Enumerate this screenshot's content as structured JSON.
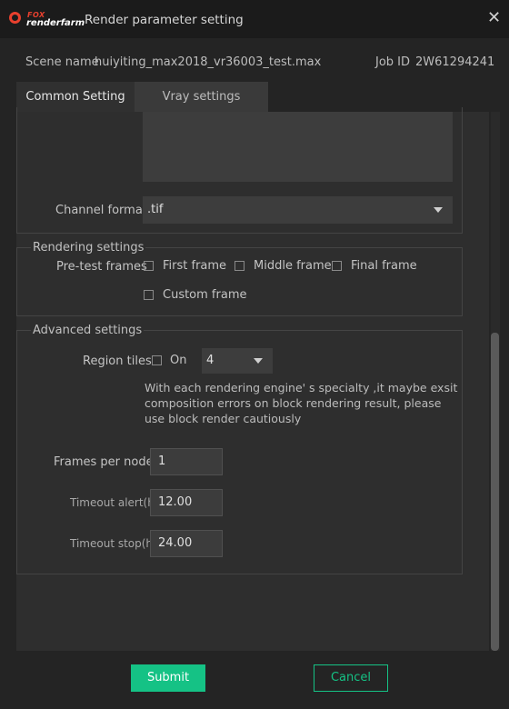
{
  "window": {
    "logo_text_top": "FOX",
    "logo_text_bottom": "renderfarm",
    "title": "Render parameter setting",
    "close_symbol": "✕"
  },
  "meta": {
    "scene_label": "Scene name",
    "scene_value": "huiyiting_max2018_vr36003_test.max",
    "job_label": "Job ID",
    "job_value": "2W61294241"
  },
  "tabs": [
    {
      "label": "Common Setting",
      "active": true
    },
    {
      "label": "Vray settings",
      "active": false
    }
  ],
  "output": {
    "channel_format_label": "Channel format",
    "channel_format_value": ".tif"
  },
  "rendering_settings": {
    "legend": "Rendering settings",
    "pretest_label": "Pre-test frames",
    "options": {
      "first": "First frame",
      "middle": "Middle frame",
      "final": "Final frame",
      "custom": "Custom frame"
    }
  },
  "advanced_settings": {
    "legend": "Advanced settings",
    "region_tiles_label": "Region tiles",
    "region_on_label": "On",
    "region_tiles_value": "4",
    "note_lines": [
      "With each rendering engine' s specialty ,it maybe exsit",
      "composition errors on block rendering result, please",
      "use block render cautiously"
    ],
    "frames_per_node_label": "Frames per node",
    "frames_per_node_value": "1",
    "timeout_alert_label": "Timeout alert(h)",
    "timeout_alert_value": "12.00",
    "timeout_stop_label": "Timeout stop(h)",
    "timeout_stop_value": "24.00"
  },
  "footer": {
    "submit_label": "Submit",
    "cancel_label": "Cancel"
  },
  "colors": {
    "accent": "#15c285",
    "logo_red": "#e8402e",
    "background": "#242424",
    "panel": "#2e2e2e"
  }
}
